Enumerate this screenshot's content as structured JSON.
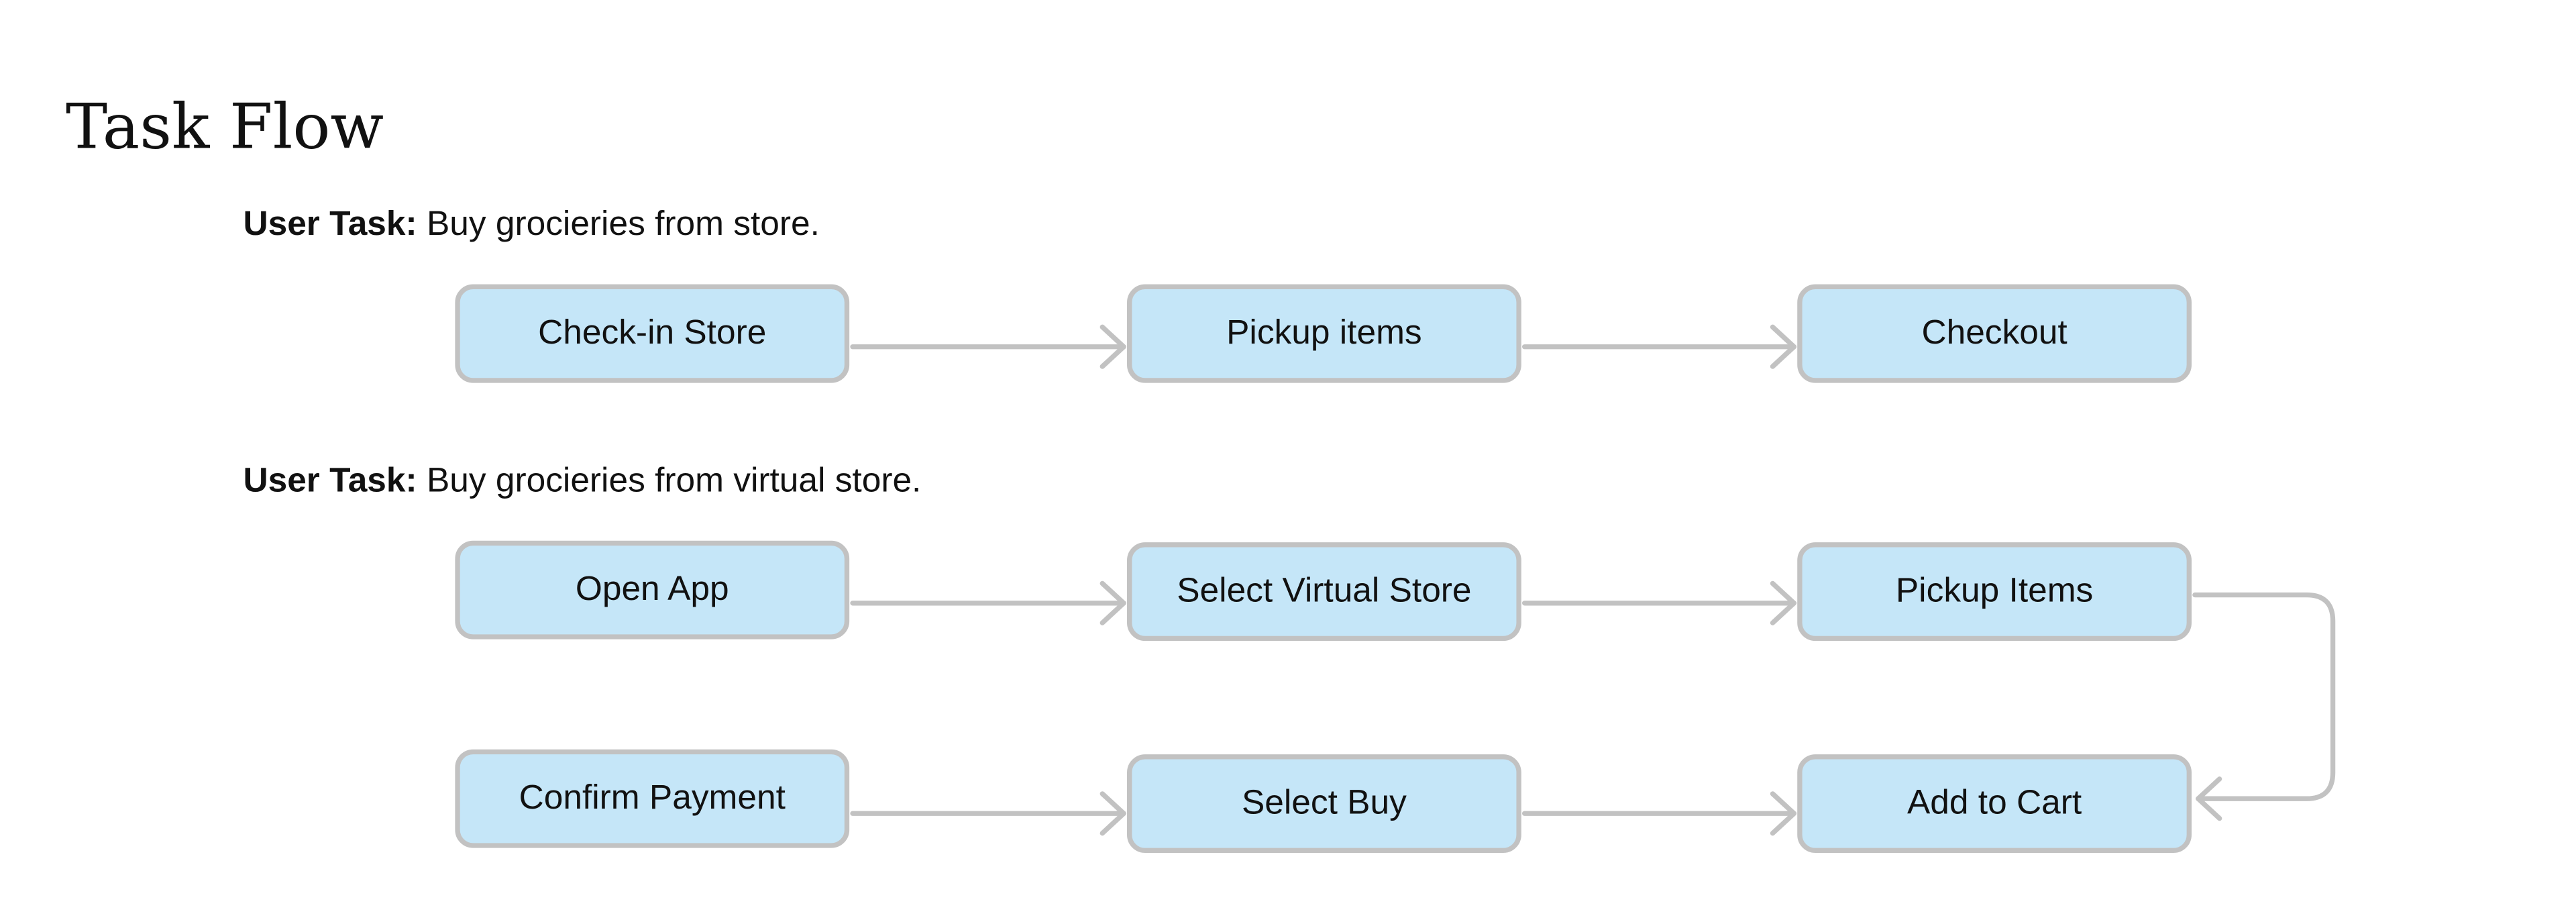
{
  "page": {
    "title": "Task Flow"
  },
  "flows": [
    {
      "task_key": "User Task:",
      "task_text": " Buy grocieries from store.",
      "steps": [
        "Check-in Store",
        "Pickup items",
        "Checkout"
      ]
    },
    {
      "task_key": "User Task:",
      "task_text": " Buy grocieries from virtual store.",
      "steps": [
        "Open App",
        "Select Virtual Store",
        "Pickup Items",
        "Add to Cart",
        "Select Buy",
        "Confirm Payment"
      ]
    }
  ],
  "colors": {
    "box_fill": "#c5e6f8",
    "box_border": "#c2c2c2",
    "connector": "#c2c2c2",
    "text": "#111111"
  }
}
